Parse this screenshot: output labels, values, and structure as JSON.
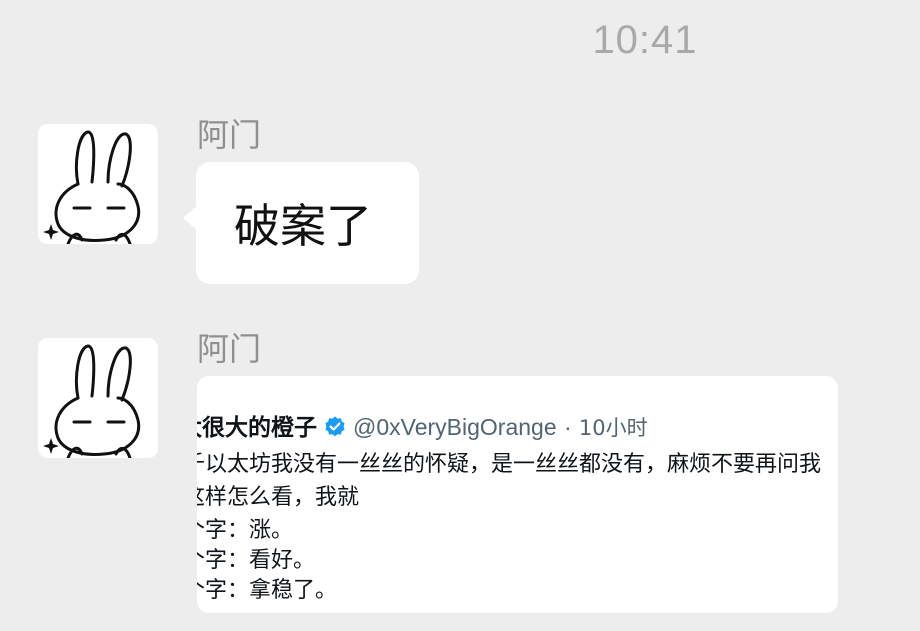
{
  "timestamp": "10:41",
  "messages": [
    {
      "sender": "阿门",
      "text": "破案了"
    },
    {
      "sender": "阿门",
      "image": {
        "tweet": {
          "name": "太很大的橙子",
          "handle": "@0xVeryBigOrange",
          "separator": "·",
          "time": "10小时",
          "lines": [
            "千以太坊我没有一丝丝的怀疑，是一丝丝都没有，麻烦不要再问我",
            "这样怎么看，我就",
            "个字：涨。",
            "个字：看好。",
            "个字：拿稳了。"
          ]
        }
      }
    }
  ],
  "colors": {
    "background": "#ededed",
    "bubble": "#ffffff",
    "verified": "#1d9bf0"
  },
  "icons": {
    "avatar": "rabbit-avatar-icon",
    "verified": "verified-badge-icon"
  }
}
